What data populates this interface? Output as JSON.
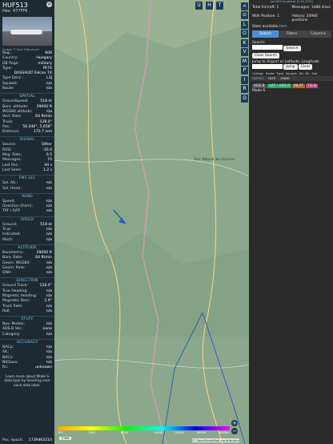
{
  "aircraft": {
    "callsign": "HUF513",
    "hex_label": "Hex:",
    "hex": "477FF6",
    "photo_credit": "Image © Ilan Zilberbush",
    "reg_rows": [
      {
        "k": "Reg.:",
        "v": "606"
      },
      {
        "k": "Country:",
        "v": "Hungary"
      },
      {
        "k": "DB flags:",
        "v": "military"
      },
      {
        "k": "Type:",
        "v": "FA7X"
      },
      {
        "k": "",
        "v": "DASSAULT Falcon 7X"
      },
      {
        "k": "Type Desc.:",
        "v": "L3J"
      },
      {
        "k": "Squawk:",
        "v": "n/a"
      },
      {
        "k": "Route:",
        "v": "n/a"
      }
    ],
    "sections": [
      {
        "title": "SPATIAL",
        "rows": [
          {
            "k": "Groundspeed:",
            "v": "518 kt"
          },
          {
            "k": "Baro. altitude:",
            "v": "29000 ft"
          },
          {
            "k": "WGS84 altitude:",
            "v": "n/a"
          },
          {
            "k": "Vert. Rate:",
            "v": "64 ft/min"
          },
          {
            "k": "Track:",
            "v": "128.0°"
          },
          {
            "k": "Pos.:",
            "v": "50.340°, 5.658°"
          },
          {
            "k": "Distance:",
            "v": "170.7 nmi"
          }
        ]
      },
      {
        "title": "SIGNAL",
        "rows": [
          {
            "k": "Source:",
            "v": "Other"
          },
          {
            "k": "RSSI:",
            "v": "-30.0"
          },
          {
            "k": "Msg. Rate:",
            "v": "0.5"
          },
          {
            "k": "Messages:",
            "v": "70"
          },
          {
            "k": "Last Pos.:",
            "v": "44 s"
          },
          {
            "k": "Last Seen:",
            "v": "1.2 s"
          }
        ]
      },
      {
        "title": "FMS SEL",
        "rows": [
          {
            "k": "Sel. Alt.:",
            "v": "n/a"
          },
          {
            "k": "Sel. Head.:",
            "v": "n/a"
          }
        ]
      },
      {
        "title": "WIND",
        "rows": [
          {
            "k": "Speed:",
            "v": "n/a"
          },
          {
            "k": "Direction (from):",
            "v": "n/a"
          },
          {
            "k": "TAT / OAT:",
            "v": "n/a"
          }
        ]
      },
      {
        "title": "SPEED",
        "rows": [
          {
            "k": "Ground:",
            "v": "518 kt"
          },
          {
            "k": "True:",
            "v": "n/a"
          },
          {
            "k": "Indicated:",
            "v": "n/a"
          },
          {
            "k": "Mach:",
            "v": "n/a"
          }
        ]
      },
      {
        "title": "ALTITUDE",
        "rows": [
          {
            "k": "Barometric:",
            "v": "29000 ft"
          },
          {
            "k": "Baro. Rate:",
            "v": "64 ft/min"
          },
          {
            "k": "Geom. WGS84:",
            "v": "n/a"
          },
          {
            "k": "Geom. Rate:",
            "v": "n/a"
          },
          {
            "k": "QNH:",
            "v": "n/a"
          }
        ]
      },
      {
        "title": "DIRECTION",
        "rows": [
          {
            "k": "Ground Track:",
            "v": "128.0°"
          },
          {
            "k": "True Heading:",
            "v": "n/a"
          },
          {
            "k": "Magnetic Heading:",
            "v": "n/a"
          },
          {
            "k": "Magnetic Decl.:",
            "v": "2.9°"
          },
          {
            "k": "Track Rate:",
            "v": "n/a"
          },
          {
            "k": "Roll:",
            "v": "n/a"
          }
        ]
      },
      {
        "title": "STUFF",
        "rows": [
          {
            "k": "Nav. Modes:",
            "v": "n/a"
          },
          {
            "k": "ADS-B Ver.:",
            "v": "none"
          },
          {
            "k": "Category:",
            "v": "n/a"
          }
        ]
      },
      {
        "title": "ACCURACY",
        "rows": [
          {
            "k": "NACp:",
            "v": "n/a"
          },
          {
            "k": "SIL:",
            "v": "n/a"
          },
          {
            "k": "NACv:",
            "v": "n/a"
          },
          {
            "k": "NICbaro:",
            "v": "n/a"
          },
          {
            "k": "Rc:",
            "v": "unknown"
          }
        ]
      }
    ],
    "note": "Learn more about Mode S data type by hovering over each data label.",
    "epoch_label": "Pos. epoch:",
    "epoch": "1739463210"
  },
  "toolbar": {
    "top_buttons": [
      "U",
      "H",
      "T"
    ],
    "side_buttons": [
      "<",
      "⊙",
      "L",
      "O",
      "K",
      "V",
      "M",
      "P",
      "I",
      "R",
      "D"
    ]
  },
  "stats": {
    "version": "tar1090 on github (2.14.1701)",
    "total_label": "Total Aircraft: 1",
    "messages_label": "Messages: 1488.4/sec",
    "with_pos_label": "With Position: 1",
    "history_label": "History: 20946 positions",
    "stats_label": "Stats available",
    "stats_link": "here"
  },
  "tabs": [
    "Search",
    "Filters",
    "Columns"
  ],
  "search": {
    "label": "Search:",
    "button": "Search",
    "clear": "Clear Search",
    "jump_label": "Jump to Airport or Latitude, Longitude:",
    "jump_btn": "Jump",
    "clear2": "Clear"
  },
  "table": {
    "headers": [
      "Callsign",
      "Route",
      "Type",
      "Squawk",
      "Alt. (ft)",
      "Spd."
    ],
    "row": [
      "HUF513",
      "",
      "FA7X",
      "",
      "29000",
      ""
    ]
  },
  "sources": [
    "ADS-B",
    "UAT / ADS-R",
    "MLAT",
    "TIS-B"
  ],
  "mode_s": "Mode-S",
  "legend": {
    "labels": [
      "500",
      "",
      "2000",
      "",
      "6000",
      "",
      "10000",
      "20000",
      "30000",
      "40000+"
    ]
  },
  "map": {
    "place_label": "Parc Naturel des Sources",
    "scale": "2 NM",
    "attribution": "© OpenStreetMap contributors"
  },
  "colors": {
    "accent": "#4a90d9",
    "panel": "#1e2a33",
    "section": "#7ec3e6"
  }
}
